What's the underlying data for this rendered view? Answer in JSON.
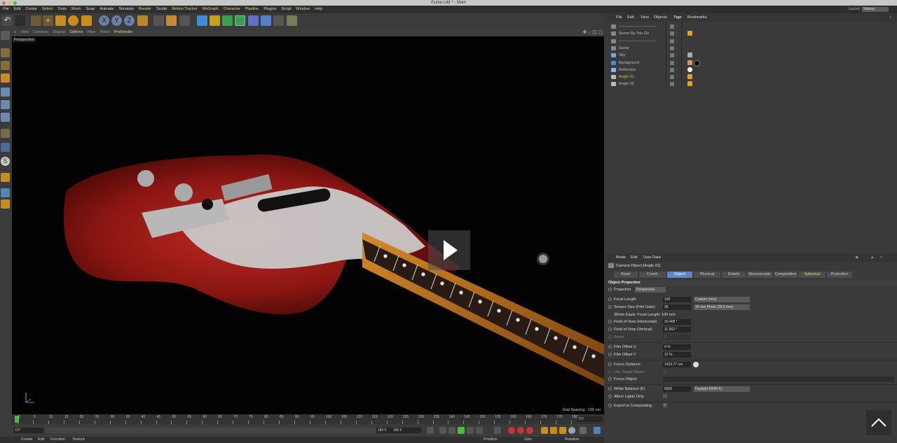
{
  "window": {
    "title": "Guitar.c4d * - Main"
  },
  "menubar": {
    "items": [
      "File",
      "Edit",
      "Create",
      "Select",
      "Tools",
      "Mesh",
      "Snap",
      "Animate",
      "Simulate",
      "Render",
      "Sculpt",
      "Motion Tracker",
      "MoGraph",
      "Character",
      "Pipeline",
      "Plugins",
      "Script",
      "Window",
      "Help"
    ],
    "highlighted": [
      "Create",
      "Select",
      "Mesh",
      "Render",
      "Motion Tracker",
      "MoGraph",
      "Character",
      "Pipeline",
      "Window",
      "Help"
    ],
    "layout_label": "Layout:",
    "layout_value": "Startup"
  },
  "viewport": {
    "menu": [
      "View",
      "Cameras",
      "Display",
      "Options",
      "Filter",
      "Panel",
      "ProRender"
    ],
    "highlighted": [
      "Options",
      "ProRender"
    ],
    "camera_label": "Perspective",
    "grid_spacing": "Grid Spacing : 100 cm"
  },
  "timeline": {
    "ticks": [
      "0",
      "5",
      "10",
      "15",
      "20",
      "25",
      "30",
      "35",
      "40",
      "45",
      "50",
      "55",
      "60",
      "65",
      "70",
      "75",
      "80",
      "85",
      "90",
      "95",
      "100",
      "105",
      "110",
      "115",
      "120",
      "125",
      "130",
      "135",
      "140",
      "145",
      "150",
      "155",
      "160",
      "165",
      "170",
      "175",
      "180"
    ],
    "current_frame_right": "0 F",
    "start_field": "0 F",
    "end_field_a": "180 F",
    "end_field_b": "180 F"
  },
  "bottombar": {
    "left": [
      "Create",
      "Edit",
      "Function",
      "Texture"
    ],
    "right": [
      "Position",
      "Size",
      "Rotation"
    ]
  },
  "object_manager": {
    "menu": [
      "File",
      "Edit",
      "View",
      "Objects",
      "Tags",
      "Bookmarks"
    ],
    "active_menu": "Tags",
    "rows": [
      {
        "name": "-----------------------------",
        "color": "#bbbbbb"
      },
      {
        "name": "Scene By Yan Ge",
        "color": "#bbbbbb"
      },
      {
        "name": "-----------------------------",
        "color": "#bbbbbb"
      },
      {
        "name": "Guitar",
        "color": "#bbbbbb"
      },
      {
        "name": "Sky",
        "color": "#bbbbbb"
      },
      {
        "name": "Background",
        "color": "#bbbbbb"
      },
      {
        "name": "Reflection",
        "color": "#bbbbbb"
      },
      {
        "name": "Angle 01",
        "color": "#e6b64a"
      },
      {
        "name": "Angle 02",
        "color": "#bbbbbb"
      }
    ]
  },
  "attribute_manager": {
    "menu": [
      "Mode",
      "Edit",
      "User Data"
    ],
    "title": "Camera Object [Angle 01]",
    "tabs": [
      "Basic",
      "Coord.",
      "Object",
      "Physical",
      "Details",
      "Stereoscopic",
      "Composition",
      "Spherical",
      "Protection"
    ],
    "active_tab": "Object",
    "section": "Object Properties",
    "projection_label": "Projection",
    "projection_value": "Perspective",
    "focal_length_label": "Focal Length",
    "focal_length_value": "100",
    "focal_length_preset": "Custom (mm)",
    "sensor_size_label": "Sensor Size (Film Gate)",
    "sensor_size_value": "36",
    "sensor_size_preset": "35 mm Photo (36.0 mm)",
    "equiv_focal": "35mm Equiv. Focal Length: 100 mm",
    "fov_h_label": "Field of View (Horizontal)",
    "fov_h_value": "20.408 °",
    "fov_v_label": "Field of View (Vertical)",
    "fov_v_value": "11.563 °",
    "zoom_label": "Zoom",
    "zoom_value": "1",
    "film_offset_x_label": "Film Offset X",
    "film_offset_x_value": "4 %",
    "film_offset_y_label": "Film Offset Y",
    "film_offset_y_value": "10 %",
    "focus_distance_label": "Focus Distance",
    "focus_distance_value": "1423.77 cm",
    "use_target_label": "Use Target Object",
    "focus_object_label": "Focus Object",
    "white_balance_label": "White Balance (K)",
    "white_balance_value": "6500",
    "white_balance_preset": "Daylight (6500 K)",
    "affect_lights_label": "Affect Lights Only",
    "export_label": "Export to Compositing",
    "export_check": "✓"
  }
}
